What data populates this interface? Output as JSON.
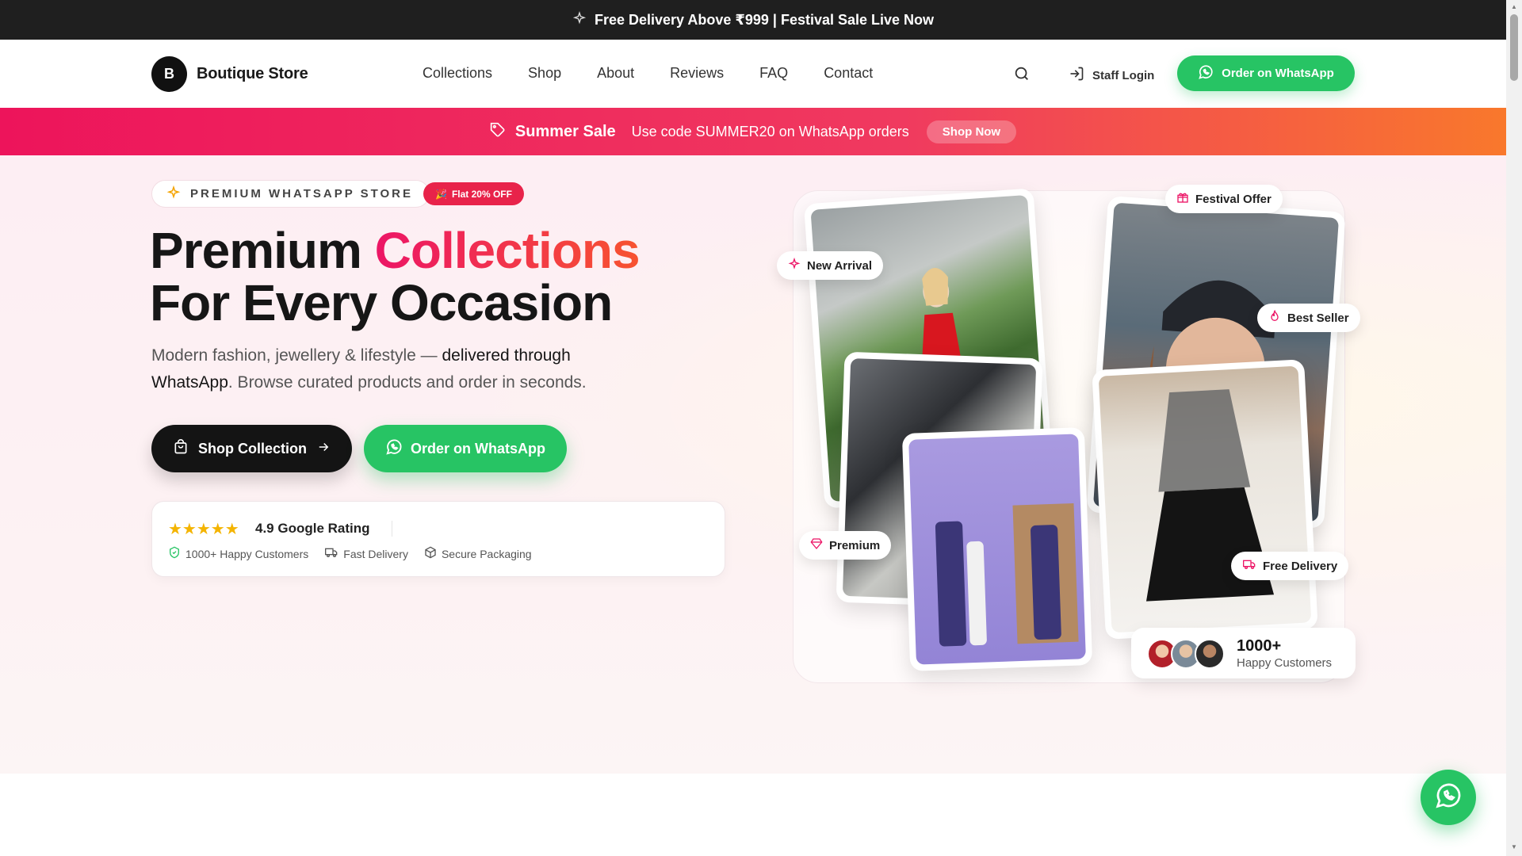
{
  "announcement": {
    "text": "Free Delivery Above ₹999 | Festival Sale Live Now",
    "icon": "sparkle-icon"
  },
  "nav": {
    "logo_letter": "B",
    "brand": "Boutique Store",
    "items": [
      "Collections",
      "Shop",
      "About",
      "Reviews",
      "FAQ",
      "Contact"
    ],
    "staff_login": "Staff Login",
    "whatsapp_cta": "Order on WhatsApp"
  },
  "promo": {
    "title": "Summer Sale",
    "message": "Use code SUMMER20 on WhatsApp orders",
    "button": "Shop Now"
  },
  "hero": {
    "badge": "PREMIUM WHATSAPP STORE",
    "discount_badge": "Flat 20% OFF",
    "headline_part1": "Premium ",
    "headline_accent": "Collections",
    "headline_part2": "For Every Occasion",
    "sub_part1": "Modern fashion, jewellery & lifestyle — ",
    "sub_bold": "delivered through WhatsApp",
    "sub_part2": ". Browse curated products and order in seconds.",
    "primary_button": "Shop Collection",
    "secondary_button": "Order on WhatsApp",
    "rating_text": "4.9 Google Rating",
    "rating_stars": 5,
    "perks": [
      "1000+ Happy Customers",
      "Fast Delivery",
      "Secure Packaging"
    ]
  },
  "collage": {
    "chips": {
      "new_arrival": "New Arrival",
      "festival_offer": "Festival Offer",
      "best_seller": "Best Seller",
      "premium": "Premium",
      "free_delivery": "Free Delivery"
    },
    "customers_count": "1000+",
    "customers_label": "Happy Customers"
  },
  "colors": {
    "accent_pink": "#ec1566",
    "whatsapp_green": "#27c464",
    "dark": "#141414"
  }
}
